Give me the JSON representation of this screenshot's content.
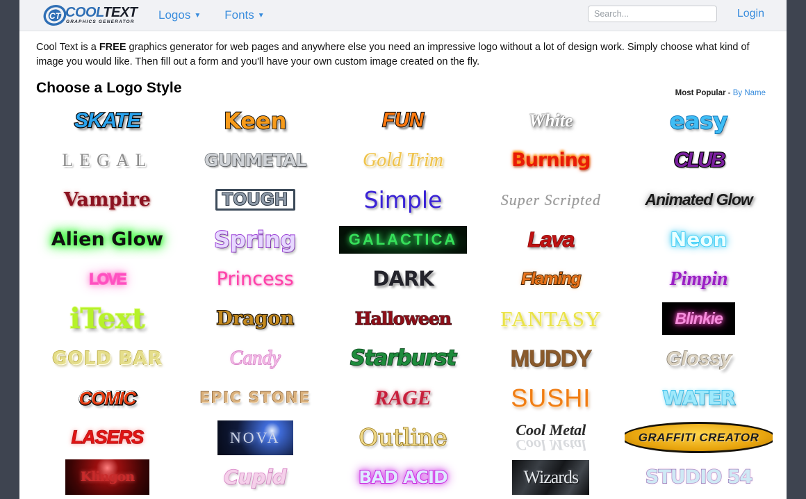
{
  "header": {
    "brand": {
      "cool": "COOL",
      "text": "TEXT",
      "tagline": "GRAPHICS GENERATOR"
    },
    "nav": [
      {
        "label": "Logos",
        "caret": "▼"
      },
      {
        "label": "Fonts",
        "caret": "▼"
      }
    ],
    "search": {
      "placeholder": "Search...",
      "value": ""
    },
    "login_label": "Login"
  },
  "intro": {
    "before": "Cool Text is a ",
    "bold": "FREE",
    "after": " graphics generator for web pages and anywhere else you need an impressive logo without a lot of design work.  Simply choose what kind of image you would like. Then fill out a form and you'll have your own custom image created on the fly."
  },
  "section": {
    "title": "Choose a Logo Style",
    "sort_active": "Most Popular",
    "sort_separator": " - ",
    "sort_link": "By Name"
  },
  "styles": [
    {
      "label": "SKATE",
      "cls": "s-skate"
    },
    {
      "label": "Keen",
      "cls": "s-keen"
    },
    {
      "label": "FUN",
      "cls": "s-fun"
    },
    {
      "label": "White",
      "cls": "s-white"
    },
    {
      "label": "easy",
      "cls": "s-easy"
    },
    {
      "label": "LEGAL",
      "cls": "s-legal"
    },
    {
      "label": "GUNMETAL",
      "cls": "s-gunmetal"
    },
    {
      "label": "Gold Trim",
      "cls": "s-goldtrim"
    },
    {
      "label": "Burning",
      "cls": "s-burning"
    },
    {
      "label": "CLUB",
      "cls": "s-club"
    },
    {
      "label": "Vampire",
      "cls": "s-vampire"
    },
    {
      "label": "TOUGH",
      "cls": "s-tough"
    },
    {
      "label": "Simple",
      "cls": "s-simple"
    },
    {
      "label": "Super Scripted",
      "cls": "s-superscript"
    },
    {
      "label": "Animated Glow",
      "cls": "s-animglow"
    },
    {
      "label": "Alien Glow",
      "cls": "s-alienglow"
    },
    {
      "label": "Spring",
      "cls": "s-spring"
    },
    {
      "label": "GALACTICA",
      "cls": "s-galactica"
    },
    {
      "label": "Lava",
      "cls": "s-lava"
    },
    {
      "label": "Neon",
      "cls": "s-neon"
    },
    {
      "label": "LOVE",
      "cls": "s-love"
    },
    {
      "label": "Princess",
      "cls": "s-princess"
    },
    {
      "label": "DARK",
      "cls": "s-dark"
    },
    {
      "label": "Flaming",
      "cls": "s-flaming"
    },
    {
      "label": "Pimpin",
      "cls": "s-pimpin"
    },
    {
      "label": "iText",
      "cls": "s-itext"
    },
    {
      "label": "Dragon",
      "cls": "s-dragon"
    },
    {
      "label": "Halloween",
      "cls": "s-halloween"
    },
    {
      "label": "FANTASY",
      "cls": "s-fantasy"
    },
    {
      "label": "Blinkie",
      "cls": "s-blinkie"
    },
    {
      "label": "GOLD BAR",
      "cls": "s-goldbar"
    },
    {
      "label": "Candy",
      "cls": "s-candy"
    },
    {
      "label": "Starburst",
      "cls": "s-starburst"
    },
    {
      "label": "MUDDY",
      "cls": "s-muddy"
    },
    {
      "label": "Glossy",
      "cls": "s-glossy"
    },
    {
      "label": "COMIC",
      "cls": "s-comic"
    },
    {
      "label": "EPIC STONE",
      "cls": "s-epicstone"
    },
    {
      "label": "RAGE",
      "cls": "s-rage"
    },
    {
      "label": "SUSHI",
      "cls": "s-sushi"
    },
    {
      "label": "WATER",
      "cls": "s-water"
    },
    {
      "label": "LASERS",
      "cls": "s-lasers"
    },
    {
      "label": "NOVA",
      "cls": "s-nova"
    },
    {
      "label": "Outline",
      "cls": "s-outline"
    },
    {
      "label": "Cool Metal",
      "cls": "s-coolmetal",
      "reflected": true
    },
    {
      "label": "GRAFFITI CREATOR",
      "cls": "s-graffiti"
    },
    {
      "label": "Klingon",
      "cls": "s-klingon"
    },
    {
      "label": "Cupid",
      "cls": "s-cupid"
    },
    {
      "label": "BAD ACID",
      "cls": "s-badacid"
    },
    {
      "label": "Wizards",
      "cls": "s-wizards"
    },
    {
      "label": "STUDIO 54",
      "cls": "s-studio"
    }
  ],
  "colors": {
    "page_margin": "#3e4450",
    "header_bg": "#f1f2f5",
    "link": "#3a8ddd",
    "brand_blue": "#2f6fb5"
  }
}
